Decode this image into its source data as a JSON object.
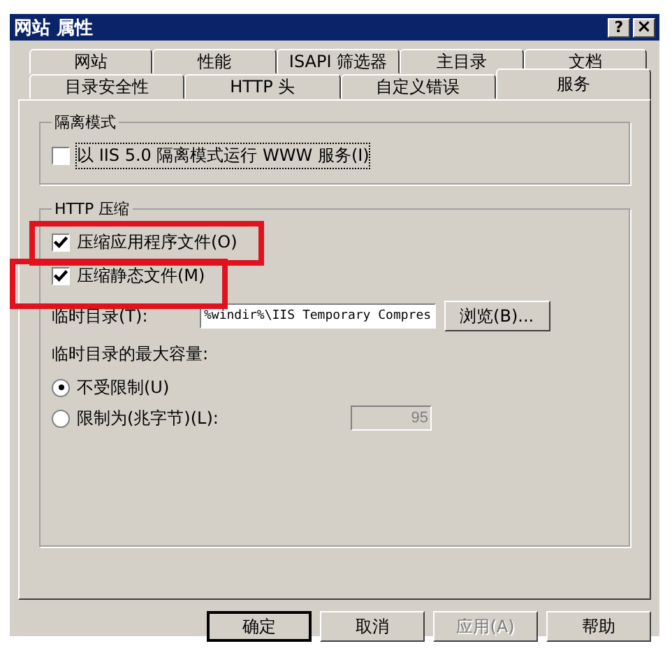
{
  "window": {
    "title": "网站 属性",
    "buttons": [
      {
        "kind": "help",
        "label": "?"
      },
      {
        "kind": "close",
        "label": "×"
      }
    ]
  },
  "tab_rows": [
    [
      {
        "label": "网站",
        "selected": false
      },
      {
        "label": "性能",
        "selected": false
      },
      {
        "label": "ISAPI 筛选器",
        "selected": false
      },
      {
        "label": "主目录",
        "selected": false
      },
      {
        "label": "文档",
        "selected": false
      }
    ],
    [
      {
        "label": "目录安全性",
        "selected": false
      },
      {
        "label": "HTTP 头",
        "selected": false
      },
      {
        "label": "自定义错误",
        "selected": false
      },
      {
        "label": "服务",
        "selected": true
      }
    ]
  ],
  "isolation": {
    "title": "隔离模式",
    "checkbox": {
      "label": "以 IIS 5.0 隔离模式运行 WWW 服务(I)",
      "checked": false
    }
  },
  "compression": {
    "title": "HTTP 压缩",
    "checkboxes": [
      {
        "label": "压缩应用程序文件(O)",
        "checked": true,
        "highlighted": true
      },
      {
        "label": "压缩静态文件(M)",
        "checked": true,
        "highlighted": true
      }
    ],
    "temp_dir": {
      "label": "临时目录(T):",
      "value": "%windir%\\IIS Temporary Compres",
      "browse": "浏览(B)..."
    },
    "max_size_label": "临时目录的最大容量:",
    "radios": [
      {
        "label": "不受限制(U)",
        "selected": true
      },
      {
        "label": "限制为(兆字节)(L):",
        "selected": false
      }
    ],
    "limit": {
      "value": "95",
      "disabled": true
    }
  },
  "buttons": [
    {
      "label": "确定",
      "default": true,
      "disabled": false
    },
    {
      "label": "取消",
      "default": false,
      "disabled": false
    },
    {
      "label": "应用(A)",
      "default": false,
      "disabled": true
    },
    {
      "label": "帮助",
      "default": false,
      "disabled": false
    }
  ]
}
